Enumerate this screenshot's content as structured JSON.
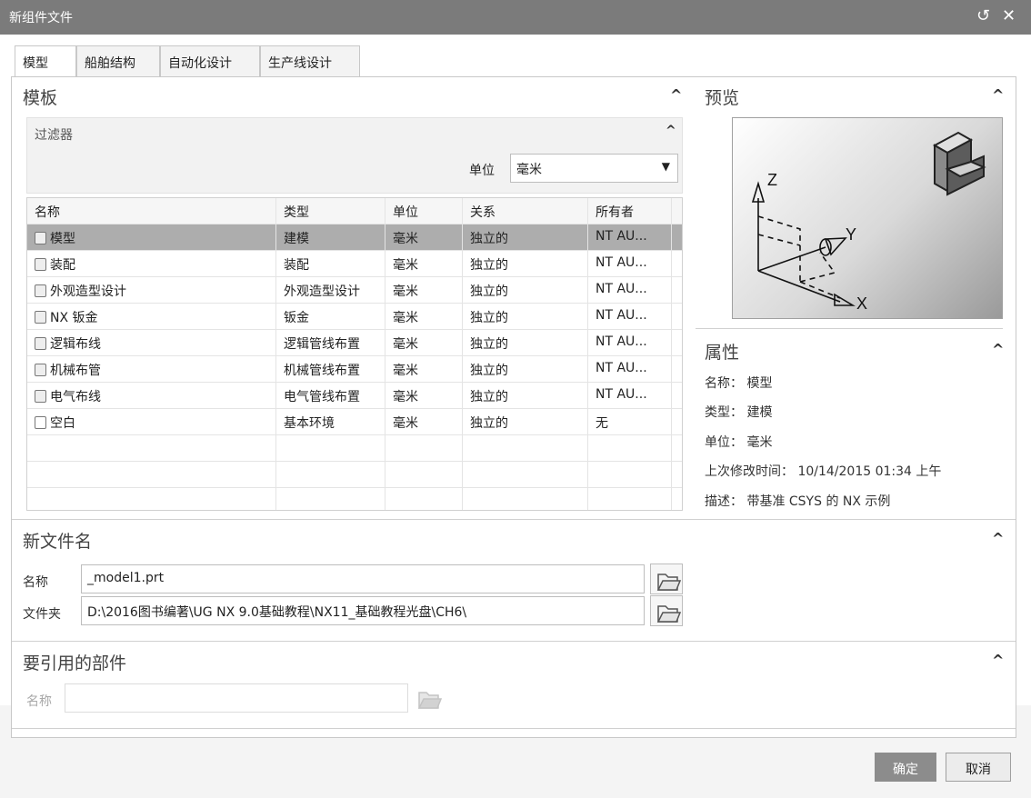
{
  "window": {
    "title": "新组件文件",
    "reset_glyph": "↺",
    "close_glyph": "✕"
  },
  "tabs": [
    "模型",
    "船舶结构",
    "自动化设计",
    "生产线设计"
  ],
  "template_section": {
    "title": "模板",
    "filter": {
      "title": "过滤器",
      "unit_label": "单位",
      "unit_value": "毫米"
    },
    "table": {
      "columns": [
        "名称",
        "类型",
        "单位",
        "关系",
        "所有者"
      ],
      "rows": [
        {
          "name": "模型",
          "type": "建模",
          "unit": "毫米",
          "relation": "独立的",
          "owner": "NT AU..."
        },
        {
          "name": "装配",
          "type": "装配",
          "unit": "毫米",
          "relation": "独立的",
          "owner": "NT AU..."
        },
        {
          "name": "外观造型设计",
          "type": "外观造型设计",
          "unit": "毫米",
          "relation": "独立的",
          "owner": "NT AU..."
        },
        {
          "name": "NX 钣金",
          "type": "钣金",
          "unit": "毫米",
          "relation": "独立的",
          "owner": "NT AU..."
        },
        {
          "name": "逻辑布线",
          "type": "逻辑管线布置",
          "unit": "毫米",
          "relation": "独立的",
          "owner": "NT AU..."
        },
        {
          "name": "机械布管",
          "type": "机械管线布置",
          "unit": "毫米",
          "relation": "独立的",
          "owner": "NT AU..."
        },
        {
          "name": "电气布线",
          "type": "电气管线布置",
          "unit": "毫米",
          "relation": "独立的",
          "owner": "NT AU..."
        },
        {
          "name": "空白",
          "type": "基本环境",
          "unit": "毫米",
          "relation": "独立的",
          "owner": "无"
        }
      ]
    }
  },
  "preview_section": {
    "title": "预览",
    "axis_z": "Z",
    "axis_y": "Y",
    "axis_x": "X"
  },
  "properties_section": {
    "title": "属性",
    "name": "名称： 模型",
    "type": "类型： 建模",
    "unit": "单位： 毫米",
    "modified": "上次修改时间： 10/14/2015 01:34 上午",
    "description": "描述： 带基准 CSYS 的 NX 示例"
  },
  "new_file_section": {
    "title": "新文件名",
    "name_label": "名称",
    "name_value": "_model1.prt",
    "folder_label": "文件夹",
    "folder_value": "D:\\2016图书编著\\UG NX 9.0基础教程\\NX11_基础教程光盘\\CH6\\"
  },
  "ref_parts_section": {
    "title": "要引用的部件",
    "name_label": "名称",
    "name_value": ""
  },
  "buttons": {
    "ok": "确定",
    "cancel": "取消"
  },
  "colors": {
    "titlebar": "#7b7b7b",
    "selected_row": "#adadad",
    "ok_button": "#8c8c8c"
  }
}
